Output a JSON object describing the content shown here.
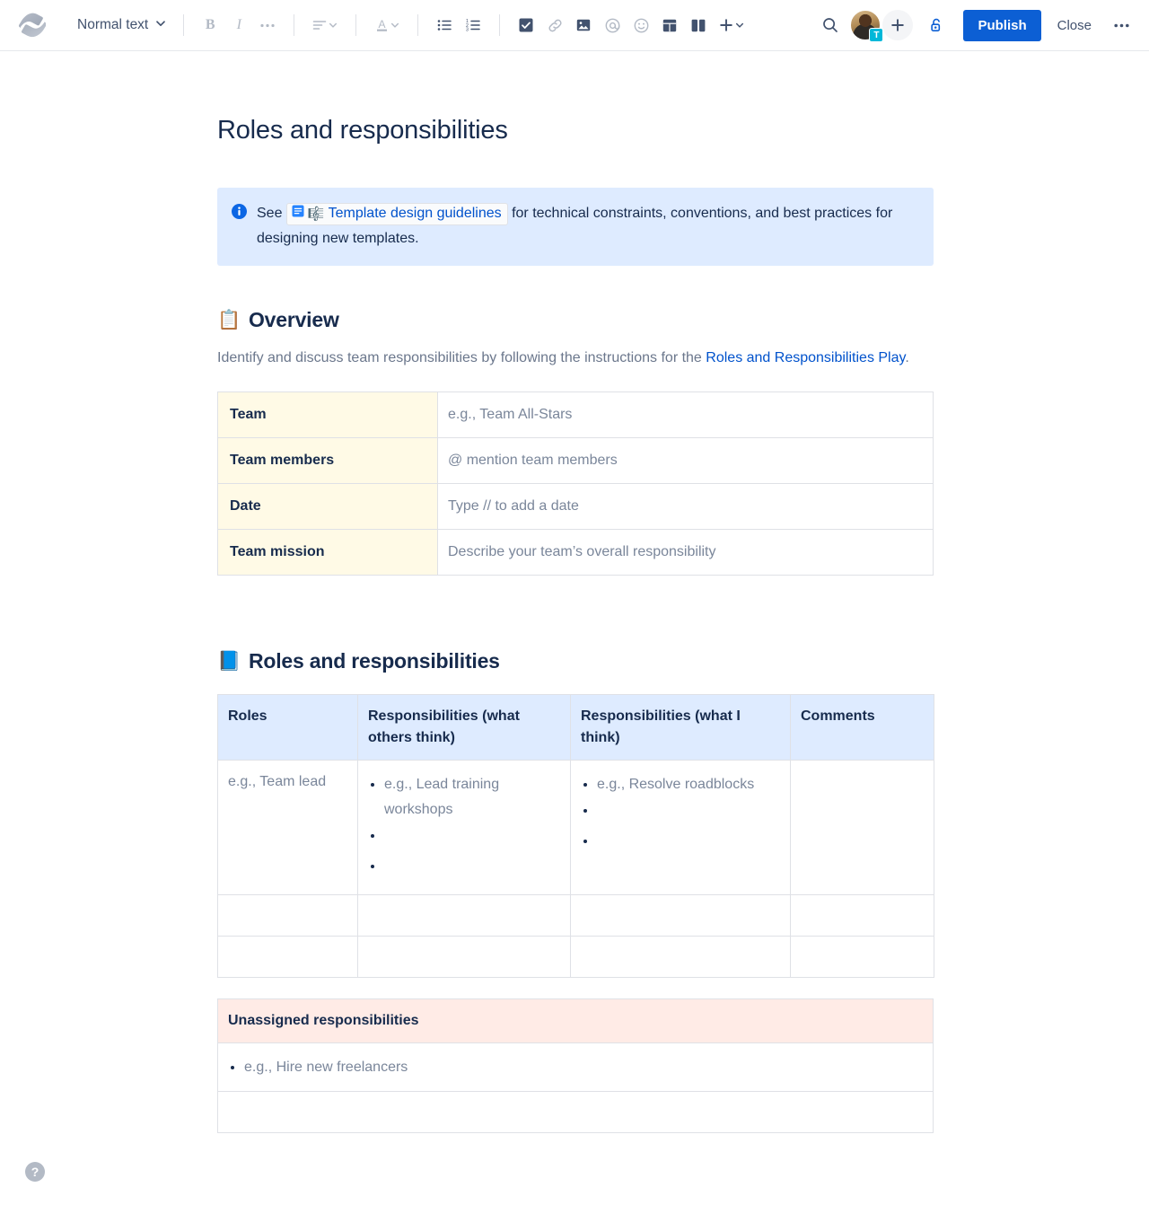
{
  "toolbar": {
    "logo_name": "confluence-logo",
    "text_style": {
      "label": "Normal text",
      "chevron": "⌄"
    },
    "buttons": [
      {
        "name": "bold",
        "glyph": "B"
      },
      {
        "name": "italic",
        "glyph": "I"
      },
      {
        "name": "more-formatting",
        "glyph": "•••"
      },
      {
        "name": "text-align",
        "glyph": "≡"
      },
      {
        "name": "text-color",
        "glyph": "A"
      },
      {
        "name": "bullet-list",
        "glyph": "≔"
      },
      {
        "name": "numbered-list",
        "glyph": "≕"
      },
      {
        "name": "action-item",
        "glyph": "☑"
      },
      {
        "name": "link",
        "glyph": "🔗"
      },
      {
        "name": "image",
        "glyph": "🖼"
      },
      {
        "name": "mention",
        "glyph": "@"
      },
      {
        "name": "emoji",
        "glyph": "☺"
      },
      {
        "name": "table",
        "glyph": "▦"
      },
      {
        "name": "layout",
        "glyph": "▯▯"
      },
      {
        "name": "insert-more",
        "glyph": "+"
      }
    ],
    "search_label": "Search",
    "avatar_badge": "T",
    "invite_label": "+",
    "restrictions_label": "Restrictions",
    "publish_label": "Publish",
    "close_label": "Close",
    "more_label": "•••"
  },
  "document": {
    "title": "Roles and responsibilities",
    "info_panel": {
      "icon": "info-icon",
      "lead": "See",
      "chip": {
        "page_icon": "page-icon",
        "note_icon": "note-icon",
        "label": "Template design guidelines"
      },
      "trail": "for technical constraints, conventions, and best practices for designing new templates."
    },
    "overview": {
      "emoji": "📋",
      "heading": "Overview",
      "paragraph_before": "Identify and discuss team responsibilities by following the instructions for the ",
      "link_text": "Roles and Responsibilities Play",
      "paragraph_after": ".",
      "rows": [
        {
          "label": "Team",
          "value": "e.g., Team All-Stars"
        },
        {
          "label": "Team members",
          "value": "@ mention team members"
        },
        {
          "label": "Date",
          "value": "Type // to add a date"
        },
        {
          "label": "Team mission",
          "value": "Describe your team’s overall responsibility"
        }
      ]
    },
    "roles_section": {
      "emoji": "📘",
      "heading": "Roles and responsibilities",
      "columns": [
        "Roles",
        "Responsibilities (what others think)",
        "Responsibilities (what I think)",
        "Comments"
      ],
      "rows": [
        {
          "role": "e.g., Team lead",
          "others_think": [
            "e.g., Lead training workshops",
            "",
            ""
          ],
          "i_think": [
            "e.g., Resolve roadblocks",
            "",
            ""
          ],
          "comments": ""
        },
        {
          "role": "",
          "others_think": [],
          "i_think": [],
          "comments": ""
        },
        {
          "role": "",
          "others_think": [],
          "i_think": [],
          "comments": ""
        }
      ]
    },
    "unassigned": {
      "heading": "Unassigned responsibilities",
      "items": [
        "e.g., Hire new freelancers"
      ],
      "empty_row": ""
    }
  },
  "help": {
    "label": "?"
  },
  "colors": {
    "accent": "#0c5fd4",
    "link": "#0052cc",
    "info_panel_bg": "#deebff",
    "table_header_blue": "#deebff",
    "table_label_yellow": "#fffae6",
    "table_header_pink": "#ffebe6",
    "text": "#172b4d",
    "muted": "#7a869a",
    "border": "#dfe1e6"
  }
}
